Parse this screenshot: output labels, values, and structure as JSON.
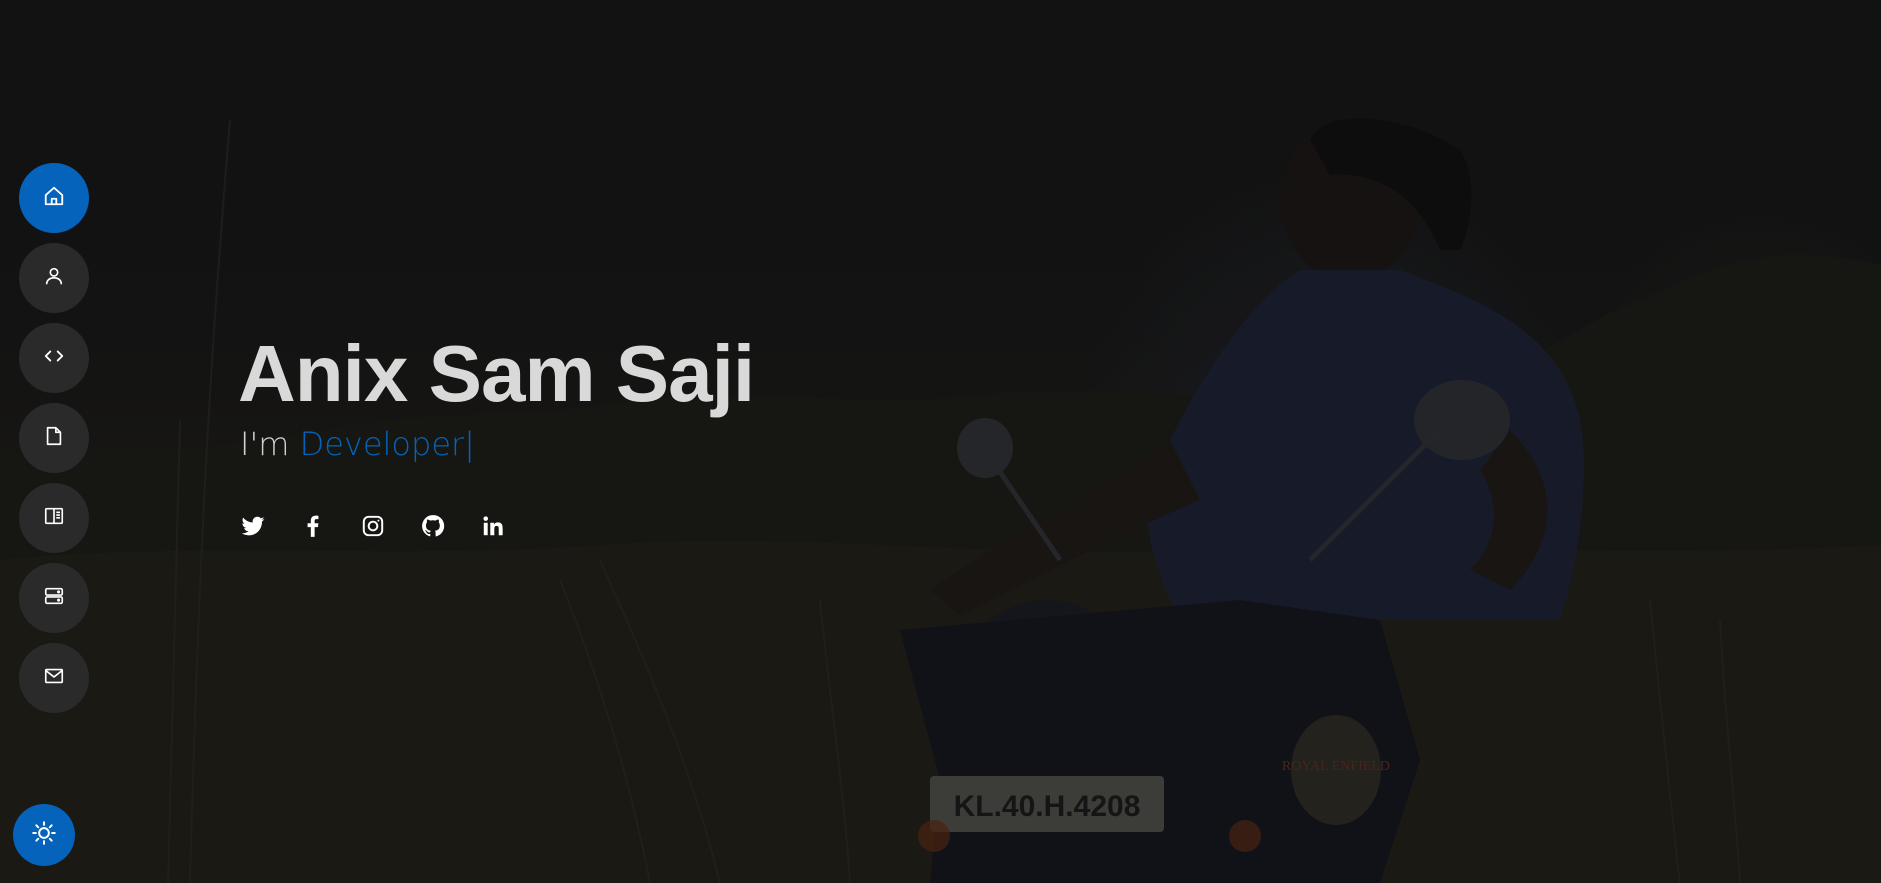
{
  "nav": {
    "items": [
      {
        "id": "home",
        "icon": "home-icon",
        "active": true
      },
      {
        "id": "about",
        "icon": "person-icon",
        "active": false
      },
      {
        "id": "skills",
        "icon": "code-icon",
        "active": false
      },
      {
        "id": "resume",
        "icon": "file-icon",
        "active": false
      },
      {
        "id": "portfolio",
        "icon": "book-half-icon",
        "active": false
      },
      {
        "id": "services",
        "icon": "server-icon",
        "active": false
      },
      {
        "id": "contact",
        "icon": "envelope-icon",
        "active": false
      }
    ],
    "theme_toggle_icon": "sun-icon"
  },
  "hero": {
    "name": "Anix Sam Saji",
    "prefix": "I'm ",
    "role": "Developer",
    "cursor": "|"
  },
  "socials": [
    {
      "id": "twitter",
      "icon": "twitter-icon"
    },
    {
      "id": "facebook",
      "icon": "facebook-icon"
    },
    {
      "id": "instagram",
      "icon": "instagram-icon"
    },
    {
      "id": "github",
      "icon": "github-icon"
    },
    {
      "id": "linkedin",
      "icon": "linkedin-icon"
    }
  ],
  "colors": {
    "accent": "#0563bb",
    "nav_bg": "#2a2a2a",
    "text": "#d9d9d9",
    "background": "#141414"
  },
  "background_plate": {
    "text": "KL.40.H.4208"
  },
  "background_badge": {
    "text": "ROYAL ENFIELD"
  }
}
